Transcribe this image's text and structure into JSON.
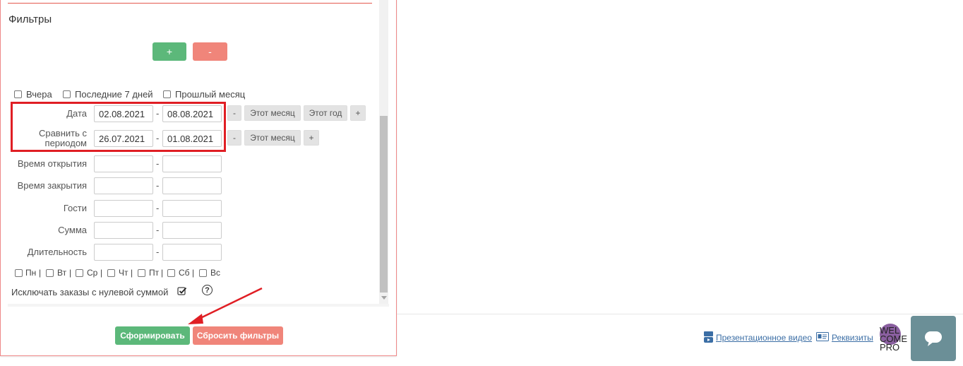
{
  "filters": {
    "title": "Фильтры",
    "add_label": "+",
    "remove_label": "-"
  },
  "quick_periods": {
    "yesterday": "Вчера",
    "last7": "Последние 7 дней",
    "last_month": "Прошлый месяц"
  },
  "date": {
    "label": "Дата",
    "from": "02.08.2021",
    "to": "08.08.2021",
    "minus": "-",
    "this_month": "Этот месяц",
    "this_year": "Этот год",
    "plus": "+"
  },
  "compare": {
    "label_line1": "Сравнить с",
    "label_line2": "периодом",
    "from": "26.07.2021",
    "to": "01.08.2021",
    "minus": "-",
    "this_month": "Этот месяц",
    "plus": "+"
  },
  "ranges": [
    {
      "label": "Время открытия",
      "from": "",
      "to": ""
    },
    {
      "label": "Время закрытия",
      "from": "",
      "to": ""
    },
    {
      "label": "Гости",
      "from": "",
      "to": ""
    },
    {
      "label": "Сумма",
      "from": "",
      "to": ""
    },
    {
      "label": "Длительность",
      "from": "",
      "to": ""
    }
  ],
  "range_separator": "-",
  "weekdays": [
    "Пн",
    "Вт",
    "Ср",
    "Чт",
    "Пт",
    "Сб",
    "Вс"
  ],
  "weekday_separator": "|",
  "exclude_zero": {
    "label": "Исключать заказы с нулевой суммой",
    "checked": true,
    "help": "?"
  },
  "actions": {
    "generate": "Сформировать",
    "reset": "Сбросить фильтры"
  },
  "footer": {
    "video_link": "Презентационное видео",
    "requisites_link": "Реквизиты",
    "logo_text": [
      "WEL",
      "COME",
      "PRO"
    ]
  },
  "colors": {
    "green": "#5cb87a",
    "red": "#f0857a",
    "highlight": "#e01e24",
    "link": "#3b6ea5",
    "chat": "#6b8f97"
  }
}
